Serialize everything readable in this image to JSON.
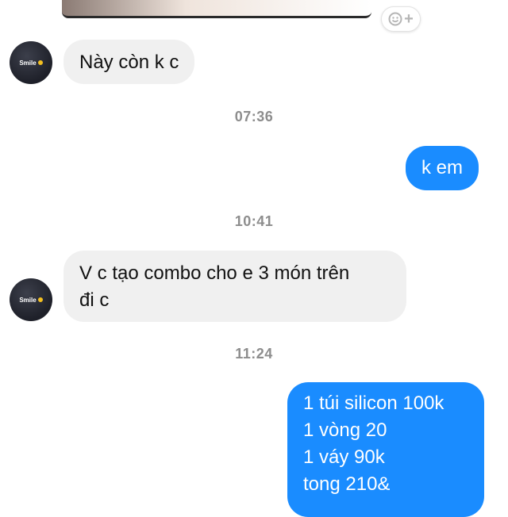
{
  "conversation": {
    "contact_avatar": {
      "text": "Smile",
      "emoji": "yellow-smiley-face"
    },
    "messages": [
      {
        "sender": "contact",
        "text": "Này còn k c"
      },
      {
        "timestamp": "07:36"
      },
      {
        "sender": "me",
        "text": "k em"
      },
      {
        "timestamp": "10:41"
      },
      {
        "sender": "contact",
        "lines": [
          "V c tạo combo cho e 3 món trên",
          "đi c"
        ]
      },
      {
        "timestamp": "11:24"
      },
      {
        "sender": "me",
        "lines": [
          "1 túi silicon 100k",
          "1 vòng 20",
          "1 váy 90k",
          "tong 210&"
        ]
      }
    ]
  },
  "icons": {
    "reaction": "emoji-add-icon"
  },
  "colors": {
    "outgoing_bubble": "#1a8cff",
    "incoming_bubble": "#f0f0f0",
    "timestamp_text": "#8d8d8d",
    "avatar_bg": "#1e2029"
  }
}
